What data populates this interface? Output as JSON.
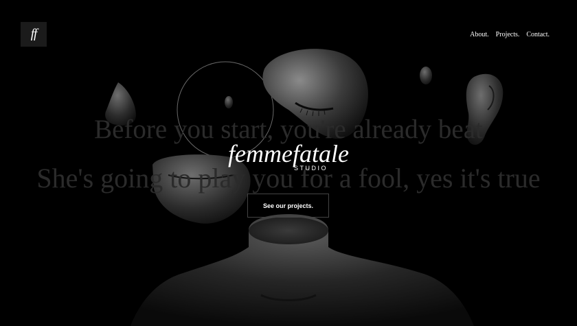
{
  "logo": {
    "text": "ff"
  },
  "nav": {
    "items": [
      "About.",
      "Projects.",
      "Contact."
    ]
  },
  "hero": {
    "lyric_line_1": "Before you start, you're already beat",
    "lyric_line_2": "She's going to play you for a fool, yes it's true",
    "brand": "femmefatale",
    "studio": "STUDIO",
    "cta_label": "See our projects."
  }
}
